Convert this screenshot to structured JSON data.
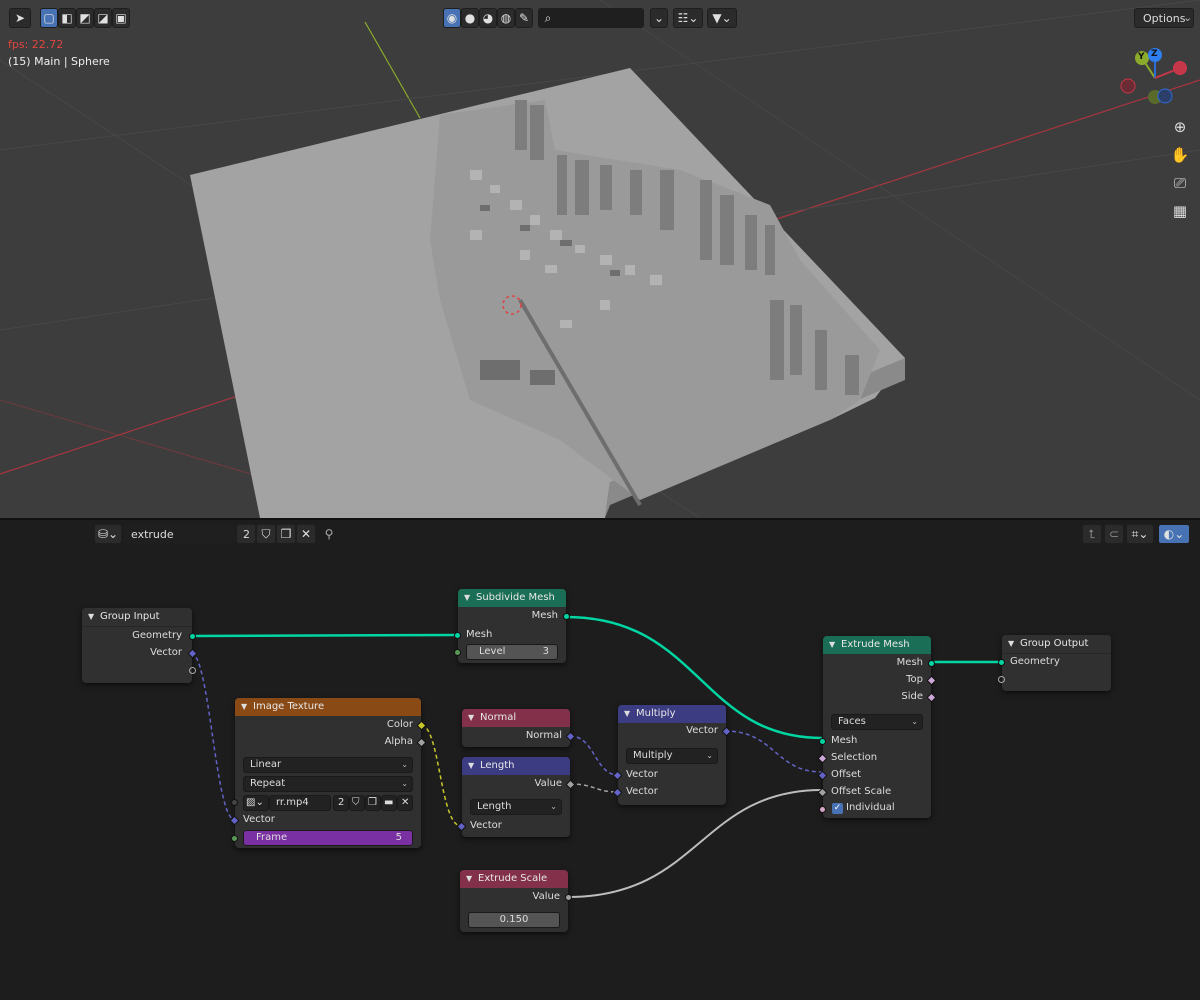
{
  "viewport": {
    "fps_text": "fps: 22.72",
    "object_text": "(15) Main | Sphere",
    "options_label": "Options",
    "search_placeholder": "",
    "gizmo": {
      "y_label": "Y",
      "z_label": "Z"
    },
    "colors": {
      "bg": "#3d3d3d",
      "x_axis": "#a8363f",
      "y_axis": "#8aab2b",
      "mesh_top": "#a3a3a3",
      "mesh_side": "#8a8a8a",
      "mesh_dark": "#6e6e6e"
    }
  },
  "node_editor": {
    "tree_name": "extrude",
    "user_count": "2",
    "nodes": {
      "group_input": {
        "title": "Group Input",
        "out_geometry": "Geometry",
        "out_vector": "Vector"
      },
      "subdivide": {
        "title": "Subdivide Mesh",
        "out_mesh": "Mesh",
        "in_mesh": "Mesh",
        "level_label": "Level",
        "level_value": "3"
      },
      "image_texture": {
        "title": "Image Texture",
        "out_color": "Color",
        "out_alpha": "Alpha",
        "interpolation": "Linear",
        "extension": "Repeat",
        "image_name": "rr.mp4",
        "image_users": "2",
        "in_vector": "Vector",
        "frame_label": "Frame",
        "frame_value": "5"
      },
      "normal": {
        "title": "Normal",
        "out_normal": "Normal"
      },
      "length": {
        "title": "Length",
        "out_value": "Value",
        "operation": "Length",
        "in_vector": "Vector"
      },
      "multiply": {
        "title": "Multiply",
        "out_vector": "Vector",
        "operation": "Multiply",
        "in_vector_a": "Vector",
        "in_vector_b": "Vector"
      },
      "extrude_scale": {
        "title": "Extrude Scale",
        "out_value": "Value",
        "value": "0.150"
      },
      "extrude_mesh": {
        "title": "Extrude Mesh",
        "out_mesh": "Mesh",
        "out_top": "Top",
        "out_side": "Side",
        "mode": "Faces",
        "in_mesh": "Mesh",
        "in_selection": "Selection",
        "in_offset": "Offset",
        "in_offset_scale": "Offset Scale",
        "individual_label": "Individual",
        "individual_checked": true
      },
      "group_output": {
        "title": "Group Output",
        "in_geometry": "Geometry"
      }
    },
    "colors": {
      "geometry_socket": "#00d6a3",
      "vector_socket": "#6363c7",
      "float_socket": "#a1a1a1",
      "color_socket": "#c7c729",
      "header_geometry": "#1b6e56",
      "header_texture": "#8a4a16",
      "header_input": "#83314a",
      "header_vector": "#3c3c83"
    }
  }
}
